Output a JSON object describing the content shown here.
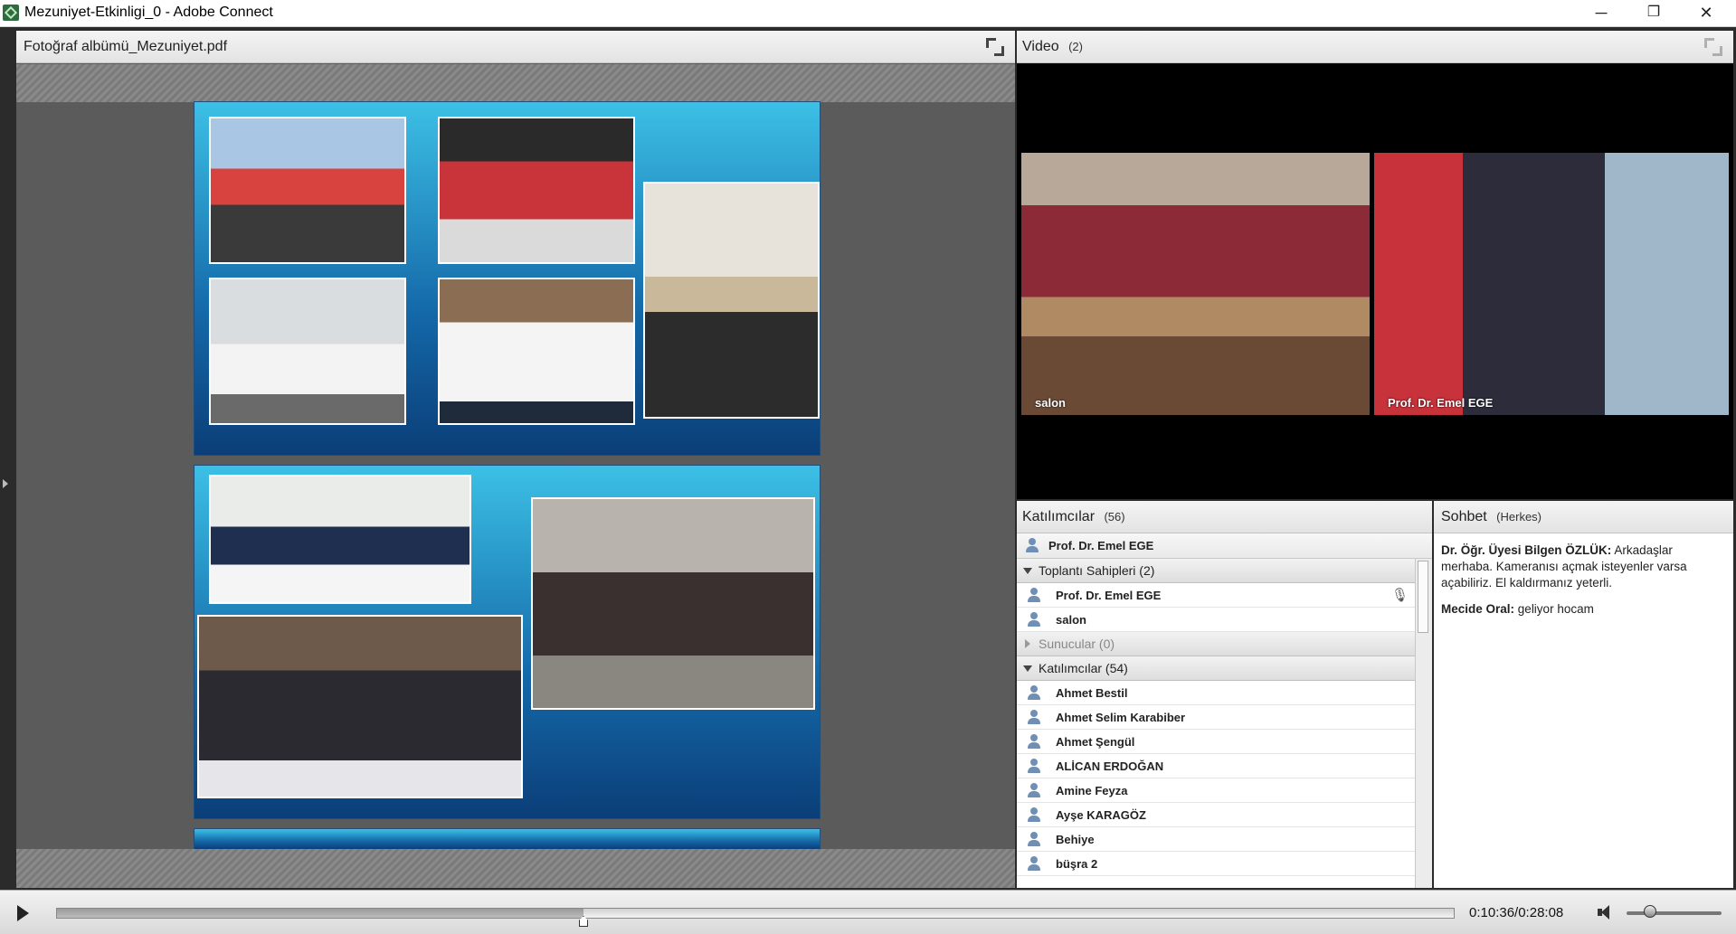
{
  "window": {
    "title": "Mezuniyet-Etkinligi_0 - Adobe Connect",
    "minimize": "─",
    "restore": "❐",
    "close": "✕"
  },
  "share_pod": {
    "title": "Fotoğraf albümü_Mezuniyet.pdf"
  },
  "video_pod": {
    "title": "Video",
    "count": "(2)",
    "feeds": [
      {
        "label": "salon"
      },
      {
        "label": "Prof. Dr. Emel EGE"
      }
    ]
  },
  "attendees_pod": {
    "title": "Katılımcılar",
    "count": "(56)",
    "presenter": "Prof. Dr. Emel EGE",
    "hosts_label": "Toplantı Sahipleri (2)",
    "hosts": [
      "Prof. Dr. Emel EGE",
      "salon"
    ],
    "presenters_label": "Sunucular (0)",
    "participants_label": "Katılımcılar (54)",
    "participants": [
      "Ahmet Bestil",
      "Ahmet Selim Karabiber",
      "Ahmet Şengül",
      "ALİCAN ERDOĞAN",
      "Amine Feyza",
      "Ayşe KARAGÖZ",
      "Behiye",
      "büşra 2"
    ]
  },
  "chat_pod": {
    "title": "Sohbet",
    "scope": "(Herkes)",
    "messages": [
      {
        "author": "Dr. Öğr. Üyesi Bilgen ÖZLÜK:",
        "text": "Arkadaşlar merhaba. Kameranısı açmak isteyenler varsa açabiliriz. El kaldırmanız yeterli."
      },
      {
        "author": "Mecide Oral:",
        "text": "geliyor hocam"
      }
    ]
  },
  "playback": {
    "time": "0:10:36/0:28:08",
    "progress": 0.377,
    "volume": 0.25
  }
}
